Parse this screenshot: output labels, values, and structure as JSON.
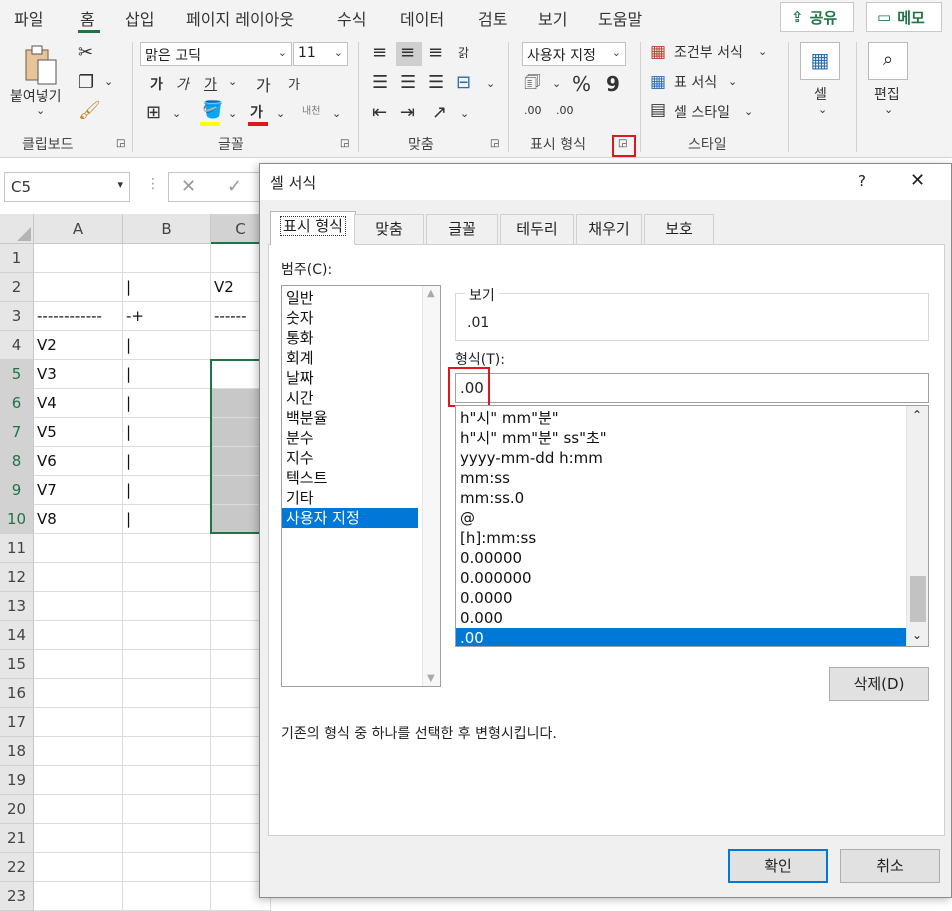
{
  "ribbon_tabs": [
    "파일",
    "홈",
    "삽입",
    "페이지 레이아웃",
    "수식",
    "데이터",
    "검토",
    "보기",
    "도움말"
  ],
  "active_tab": "홈",
  "share_label": "공유",
  "memo_label": "메모",
  "groups": {
    "clipboard": {
      "label": "클립보드",
      "paste": "붙여넣기"
    },
    "font": {
      "label": "글꼴",
      "font_name": "맑은 고딕",
      "font_size": "11",
      "bold": "가",
      "italic": "가",
      "underline": "가",
      "grow": "가",
      "shrink": "가",
      "font_color": "가",
      "phonetic": "내천"
    },
    "alignment": {
      "label": "맞춤",
      "wrap": "갉"
    },
    "number": {
      "label": "표시 형식",
      "format": "사용자 지정",
      "percent": "%",
      "comma": "9",
      "inc_decimal": ".00",
      "dec_decimal": ".00"
    },
    "styles": {
      "label": "스타일",
      "conditional": "조건부 서식",
      "table": "표 서식",
      "cell_style": "셀 스타일"
    },
    "cells": {
      "label": "셀"
    },
    "editing": {
      "label": "편집"
    }
  },
  "formula_bar": {
    "name_box": "C5"
  },
  "grid": {
    "columns": [
      "A",
      "B",
      "C"
    ],
    "rows": [
      "1",
      "2",
      "3",
      "4",
      "5",
      "6",
      "7",
      "8",
      "9",
      "10",
      "11",
      "12",
      "13",
      "14",
      "15",
      "16",
      "17",
      "18",
      "19",
      "20",
      "21",
      "22",
      "23"
    ],
    "colA": [
      "",
      "",
      "------------",
      "V2",
      "V3",
      "V4",
      "V5",
      "V6",
      "V7",
      "V8"
    ],
    "colB": [
      "",
      "|",
      "-+",
      "|",
      "|",
      "|",
      "|",
      "|",
      "|",
      "|"
    ],
    "colC": [
      "",
      "V2",
      "------",
      "",
      "",
      "",
      "",
      "",
      "",
      ""
    ]
  },
  "dialog": {
    "title": "셀 서식",
    "help": "?",
    "close": "✕",
    "tabs": [
      "표시 형식",
      "맞춤",
      "글꼴",
      "테두리",
      "채우기",
      "보호"
    ],
    "category_label": "범주(C):",
    "categories": [
      "일반",
      "숫자",
      "통화",
      "회계",
      "날짜",
      "시간",
      "백분율",
      "분수",
      "지수",
      "텍스트",
      "기타",
      "사용자 지정"
    ],
    "selected_category": "사용자 지정",
    "preview_label": "보기",
    "preview_value": ".01",
    "type_label": "형식(T):",
    "type_value": ".00",
    "formats": [
      "h\"시\" mm\"분\"",
      "h\"시\" mm\"분\" ss\"초\"",
      "yyyy-mm-dd h:mm",
      "mm:ss",
      "mm:ss.0",
      "@",
      "[h]:mm:ss",
      "0.00000",
      "0.000000",
      "0.0000",
      "0.000",
      ".00"
    ],
    "selected_format": ".00",
    "delete_button": "삭제(D)",
    "description": "기존의 형식 중 하나를 선택한 후 변형시킵니다.",
    "ok_button": "확인",
    "cancel_button": "취소"
  },
  "colors": {
    "accent": "#217346",
    "selection": "#0078d7",
    "highlight": "#e0161d"
  }
}
